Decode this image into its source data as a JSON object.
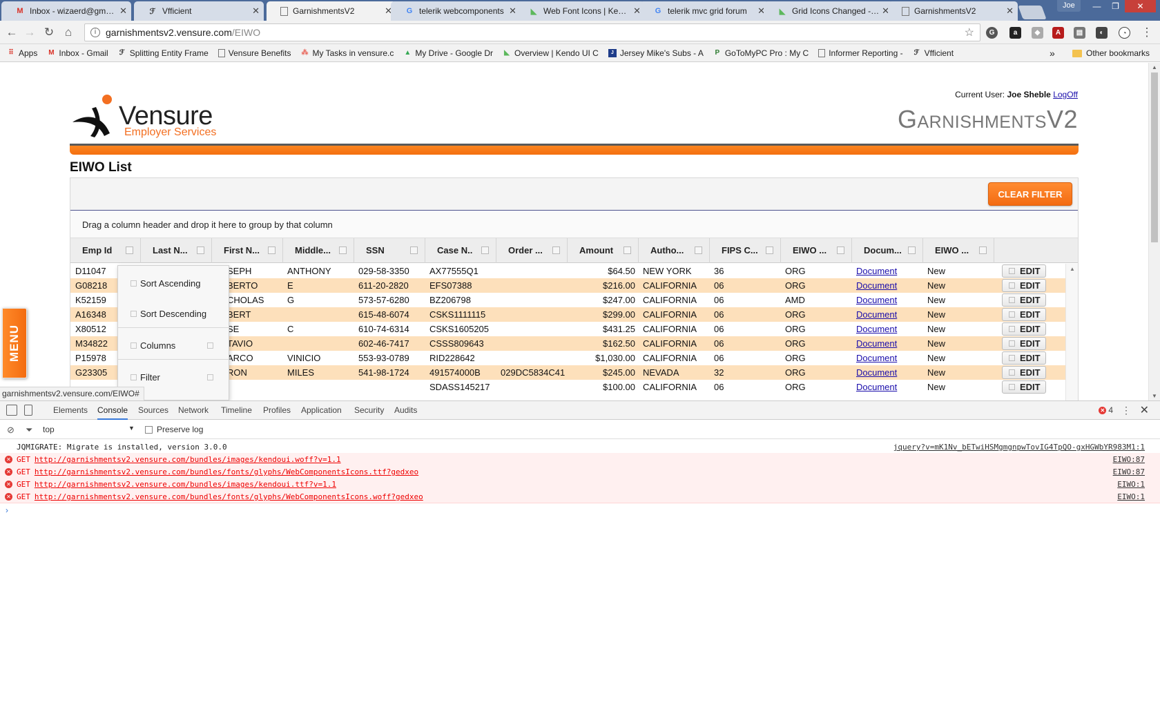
{
  "browser": {
    "tabs": [
      {
        "title": "Inbox - wizaerd@gmail.com",
        "favicon": "gmail-icon",
        "active": false
      },
      {
        "title": "Vfficient",
        "favicon": "vfficient-icon",
        "active": false
      },
      {
        "title": "GarnishmentsV2",
        "favicon": "page-icon",
        "active": true
      },
      {
        "title": "telerik webcomponents",
        "favicon": "google-icon",
        "active": false
      },
      {
        "title": "Web Font Icons | Kendo",
        "favicon": "kendo-icon",
        "active": false
      },
      {
        "title": "telerik mvc grid forum",
        "favicon": "google-icon",
        "active": false
      },
      {
        "title": "Grid Icons Changed - G",
        "favicon": "kendo-icon",
        "active": false
      },
      {
        "title": "GarnishmentsV2",
        "favicon": "page-icon",
        "active": false
      }
    ],
    "profile": "Joe",
    "address": {
      "host": "garnishmentsv2.vensure.com",
      "path": "/EIWO"
    },
    "bookmarks": [
      {
        "label": "Apps",
        "icon": "apps-grid-icon"
      },
      {
        "label": "Inbox - Gmail",
        "icon": "gmail-icon"
      },
      {
        "label": "Splitting Entity Frame",
        "icon": "vfficient-icon"
      },
      {
        "label": "Vensure Benefits",
        "icon": "page-icon"
      },
      {
        "label": "My Tasks in vensure.c",
        "icon": "asana-icon"
      },
      {
        "label": "My Drive - Google Dr",
        "icon": "drive-icon"
      },
      {
        "label": "Overview | Kendo UI C",
        "icon": "kendo-icon"
      },
      {
        "label": "Jersey Mike's Subs - A",
        "icon": "jersey-mikes-icon"
      },
      {
        "label": "GoToMyPC Pro : My C",
        "icon": "gotomypc-icon"
      },
      {
        "label": "Informer Reporting -",
        "icon": "page-icon"
      },
      {
        "label": "Vfficient",
        "icon": "vfficient-icon"
      }
    ],
    "bookmarks_more": "»",
    "other_bookmarks": "Other bookmarks",
    "status_url": "garnishmentsv2.vensure.com/EIWO#"
  },
  "header": {
    "logo_word": "Vensure",
    "logo_sub": "Employer Services",
    "current_user_label": "Current User:",
    "current_user_name": "Joe Sheble",
    "logoff": "LogOff",
    "app_title": "GarnishmentsV2"
  },
  "page": {
    "section_title": "EIWO List",
    "clear_filter": "CLEAR FILTER",
    "group_hint": "Drag a column header and drop it here to group by that column",
    "menu_tab": "MENU"
  },
  "grid": {
    "columns": [
      "Emp Id",
      "Last N...",
      "First N...",
      "Middle...",
      "SSN",
      "Case N..",
      "Order ...",
      "Amount",
      "Autho...",
      "FIPS C...",
      "EIWO ...",
      "Docum...",
      "EIWO ..."
    ],
    "rows": [
      {
        "emp_id": "D11047",
        "first": "SEPH",
        "middle": "ANTHONY",
        "ssn": "029-58-3350",
        "case": "AX77555Q1",
        "order": "",
        "amount": "$64.50",
        "authority": "NEW YORK",
        "fips": "36",
        "eiwo_type": "ORG",
        "document": "Document",
        "status": "New",
        "edit": "EDIT"
      },
      {
        "emp_id": "G08218",
        "first": "BERTO",
        "middle": "E",
        "ssn": "611-20-2820",
        "case": "EFS07388",
        "order": "",
        "amount": "$216.00",
        "authority": "CALIFORNIA",
        "fips": "06",
        "eiwo_type": "ORG",
        "document": "Document",
        "status": "New",
        "edit": "EDIT"
      },
      {
        "emp_id": "K52159",
        "first": "CHOLAS",
        "middle": "G",
        "ssn": "573-57-6280",
        "case": "BZ206798",
        "order": "",
        "amount": "$247.00",
        "authority": "CALIFORNIA",
        "fips": "06",
        "eiwo_type": "AMD",
        "document": "Document",
        "status": "New",
        "edit": "EDIT"
      },
      {
        "emp_id": "A16348",
        "first": "BERT",
        "middle": "",
        "ssn": "615-48-6074",
        "case": "CSKS1111115",
        "order": "",
        "amount": "$299.00",
        "authority": "CALIFORNIA",
        "fips": "06",
        "eiwo_type": "ORG",
        "document": "Document",
        "status": "New",
        "edit": "EDIT"
      },
      {
        "emp_id": "X80512",
        "first": "SE",
        "middle": "C",
        "ssn": "610-74-6314",
        "case": "CSKS1605205",
        "order": "",
        "amount": "$431.25",
        "authority": "CALIFORNIA",
        "fips": "06",
        "eiwo_type": "ORG",
        "document": "Document",
        "status": "New",
        "edit": "EDIT"
      },
      {
        "emp_id": "M34822",
        "first": "TAVIO",
        "middle": "",
        "ssn": "602-46-7417",
        "case": "CSSS809643",
        "order": "",
        "amount": "$162.50",
        "authority": "CALIFORNIA",
        "fips": "06",
        "eiwo_type": "ORG",
        "document": "Document",
        "status": "New",
        "edit": "EDIT"
      },
      {
        "emp_id": "P15978",
        "first": "ARCO",
        "middle": "VINICIO",
        "ssn": "553-93-0789",
        "case": "RID228642",
        "order": "",
        "amount": "$1,030.00",
        "authority": "CALIFORNIA",
        "fips": "06",
        "eiwo_type": "ORG",
        "document": "Document",
        "status": "New",
        "edit": "EDIT"
      },
      {
        "emp_id": "G23305",
        "first": "RON",
        "middle": "MILES",
        "ssn": "541-98-1724",
        "case": "491574000B",
        "order": "029DC5834C41",
        "amount": "$245.00",
        "authority": "NEVADA",
        "fips": "32",
        "eiwo_type": "ORG",
        "document": "Document",
        "status": "New",
        "edit": "EDIT"
      },
      {
        "emp_id": "",
        "first": "",
        "middle": "",
        "ssn": "",
        "case": "SDASS145217",
        "order": "",
        "amount": "$100.00",
        "authority": "CALIFORNIA",
        "fips": "06",
        "eiwo_type": "ORG",
        "document": "Document",
        "status": "New",
        "edit": "EDIT"
      }
    ]
  },
  "column_menu": {
    "sort_asc": "Sort Ascending",
    "sort_desc": "Sort Descending",
    "columns": "Columns",
    "filter": "Filter"
  },
  "devtools": {
    "tabs": [
      "Elements",
      "Console",
      "Sources",
      "Network",
      "Timeline",
      "Profiles",
      "Application",
      "Security",
      "Audits"
    ],
    "active_tab": "Console",
    "error_count": "4",
    "context": "top",
    "preserve_log": "Preserve log",
    "console": [
      {
        "level": "log",
        "method": "",
        "text": "JQMIGRATE: Migrate is installed, version 3.0.0",
        "source": "jquery?v=mK1Nv_bETwiHSMgmgnpwTovIG4TpQO-gxHGWbYR983M1:1"
      },
      {
        "level": "error",
        "method": "GET",
        "text": "http://garnishmentsv2.vensure.com/bundles/images/kendoui.woff?v=1.1",
        "source": "EIWO:87"
      },
      {
        "level": "error",
        "method": "GET",
        "text": "http://garnishmentsv2.vensure.com/bundles/fonts/glyphs/WebComponentsIcons.ttf?gedxeo",
        "source": "EIWO:87"
      },
      {
        "level": "error",
        "method": "GET",
        "text": "http://garnishmentsv2.vensure.com/bundles/images/kendoui.ttf?v=1.1",
        "source": "EIWO:1"
      },
      {
        "level": "error",
        "method": "GET",
        "text": "http://garnishmentsv2.vensure.com/bundles/fonts/glyphs/WebComponentsIcons.woff?gedxeo",
        "source": "EIWO:1"
      }
    ],
    "prompt": "›"
  },
  "colors": {
    "accent_orange": "#f36f21",
    "row_alt": "#fde0bb",
    "link": "#1a0dab",
    "error": "#e53935"
  }
}
